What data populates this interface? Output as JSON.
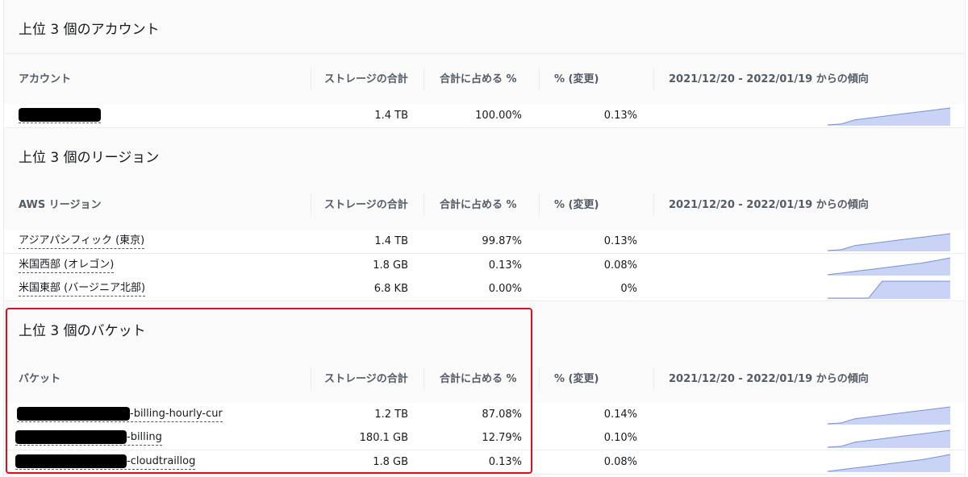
{
  "columns": {
    "storage": "ストレージの合計",
    "share": "合計に占める %",
    "change": "% (変更)",
    "trend": "2021/12/20 - 2022/01/19 からの傾向"
  },
  "sections": [
    {
      "title": "上位 3 個のアカウント",
      "first_column": "アカウント",
      "rows": [
        {
          "name": "",
          "storage": "1.4 TB",
          "share": "100.00%",
          "change": "0.13%",
          "trend": [
            0.0,
            0.05,
            0.3,
            0.4,
            0.5,
            0.6,
            0.7,
            0.8,
            0.9,
            1.0
          ]
        }
      ]
    },
    {
      "title": "上位 3 個のリージョン",
      "first_column": "AWS リージョン",
      "rows": [
        {
          "name": "アジアパシフィック (東京)",
          "storage": "1.4 TB",
          "share": "99.87%",
          "change": "0.13%",
          "trend": [
            0.0,
            0.05,
            0.3,
            0.4,
            0.5,
            0.6,
            0.7,
            0.8,
            0.9,
            1.0
          ]
        },
        {
          "name": "米国西部 (オレゴン)",
          "storage": "1.8 GB",
          "share": "0.13%",
          "change": "0.08%",
          "trend": [
            0.0,
            0.1,
            0.2,
            0.3,
            0.4,
            0.5,
            0.6,
            0.7,
            0.85,
            1.0
          ]
        },
        {
          "name": "米国東部 (バージニア北部)",
          "storage": "6.8 KB",
          "share": "0.00%",
          "change": "0%",
          "trend": [
            0.0,
            0.0,
            0.0,
            0.0,
            1.0,
            1.0,
            1.0,
            1.0,
            1.0,
            1.0
          ]
        }
      ]
    },
    {
      "title": "上位 3 個のバケット",
      "first_column": "バケット",
      "rows": [
        {
          "name": "-billing-hourly-cur",
          "storage": "1.2 TB",
          "share": "87.08%",
          "change": "0.14%",
          "trend": [
            0.0,
            0.05,
            0.3,
            0.4,
            0.5,
            0.6,
            0.7,
            0.8,
            0.9,
            1.0
          ]
        },
        {
          "name": "-billing",
          "storage": "180.1 GB",
          "share": "12.79%",
          "change": "0.10%",
          "trend": [
            0.0,
            0.05,
            0.3,
            0.4,
            0.5,
            0.6,
            0.7,
            0.8,
            0.9,
            1.0
          ]
        },
        {
          "name": "-cloudtraillog",
          "storage": "1.8 GB",
          "share": "0.13%",
          "change": "0.08%",
          "trend": [
            0.0,
            0.1,
            0.2,
            0.3,
            0.4,
            0.5,
            0.6,
            0.7,
            0.85,
            1.0
          ]
        }
      ]
    }
  ],
  "colors": {
    "spark_fill": "#c8d3f5",
    "spark_line": "#7b8fd6",
    "highlight": "#e00d1c"
  }
}
